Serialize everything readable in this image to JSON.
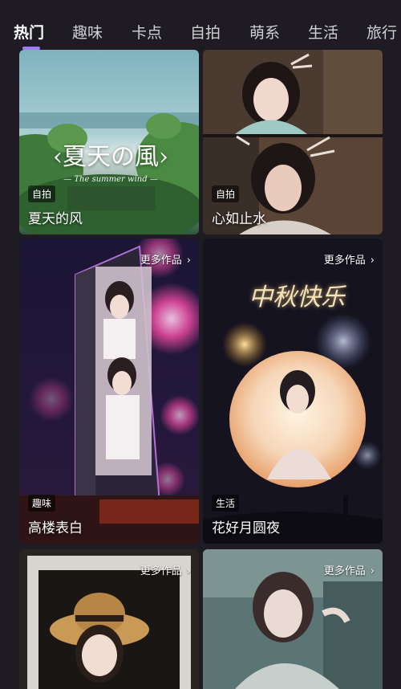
{
  "tabs": [
    {
      "label": "热门",
      "active": true
    },
    {
      "label": "趣味",
      "active": false
    },
    {
      "label": "卡点",
      "active": false
    },
    {
      "label": "自拍",
      "active": false
    },
    {
      "label": "萌系",
      "active": false
    },
    {
      "label": "生活",
      "active": false
    },
    {
      "label": "旅行",
      "active": false
    }
  ],
  "accent_color": "#9b7cf5",
  "more_label": "更多作品",
  "cards": [
    {
      "tag": "自拍",
      "title": "夏天的风",
      "overlay_title": "‹夏天の風›",
      "overlay_subtitle": "— The summer wind —"
    },
    {
      "tag": "自拍",
      "title": "心如止水"
    },
    {
      "tag": "趣味",
      "title": "高楼表白"
    },
    {
      "tag": "生活",
      "title": "花好月圆夜",
      "overlay_title": "中秋快乐"
    },
    {
      "tag": "",
      "title": ""
    },
    {
      "tag": "",
      "title": ""
    }
  ]
}
